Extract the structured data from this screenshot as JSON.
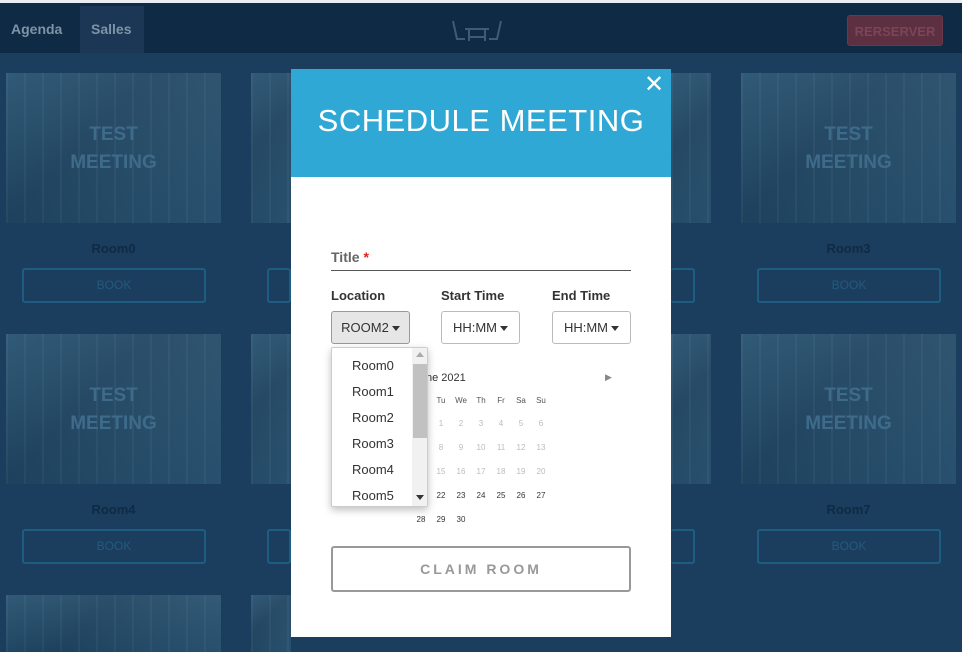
{
  "nav": {
    "agenda": "Agenda",
    "salles": "Salles",
    "reserve": "RERSERVER"
  },
  "logo_icon": "table-chairs-icon",
  "rooms": [
    {
      "overlay": "TEST\nMEETING",
      "name": "Room0",
      "book": "BOOK"
    },
    {
      "overlay": "TEST\nMEETING",
      "name": "Room3",
      "book": "BOOK"
    },
    {
      "overlay": "TEST\nMEETING",
      "name": "Room4",
      "book": "BOOK"
    },
    {
      "overlay": "TEST\nMEETING",
      "name": "Room7",
      "book": "BOOK"
    }
  ],
  "modal": {
    "title": "SCHEDULE MEETING",
    "close_icon": "close-icon",
    "title_label": "Title",
    "required_mark": "*",
    "location_label": "Location",
    "start_label": "Start Time",
    "end_label": "End Time",
    "location_value": "ROOM2",
    "start_value": "HH:MM",
    "end_value": "HH:MM",
    "claim_label": "CLAIM ROOM"
  },
  "location_options": [
    "Room0",
    "Room1",
    "Room2",
    "Room3",
    "Room4",
    "Room5"
  ],
  "calendar": {
    "month_label": "ne 2021",
    "weekdays": [
      "Tu",
      "We",
      "Th",
      "Fr",
      "Sa",
      "Su"
    ],
    "rows": [
      [
        "1",
        "2",
        "3",
        "4",
        "5",
        "6"
      ],
      [
        "8",
        "9",
        "10",
        "11",
        "12",
        "13"
      ],
      [
        "15",
        "16",
        "17",
        "18",
        "19",
        "20"
      ],
      [
        "22",
        "23",
        "24",
        "25",
        "26",
        "27"
      ]
    ],
    "last_row": [
      "28",
      "29",
      "30"
    ]
  },
  "colors": {
    "header": "#2fa8d6",
    "nav_bg": "#0f2a45",
    "overlay_bg": "#1c3e5e",
    "required": "#e02020"
  }
}
